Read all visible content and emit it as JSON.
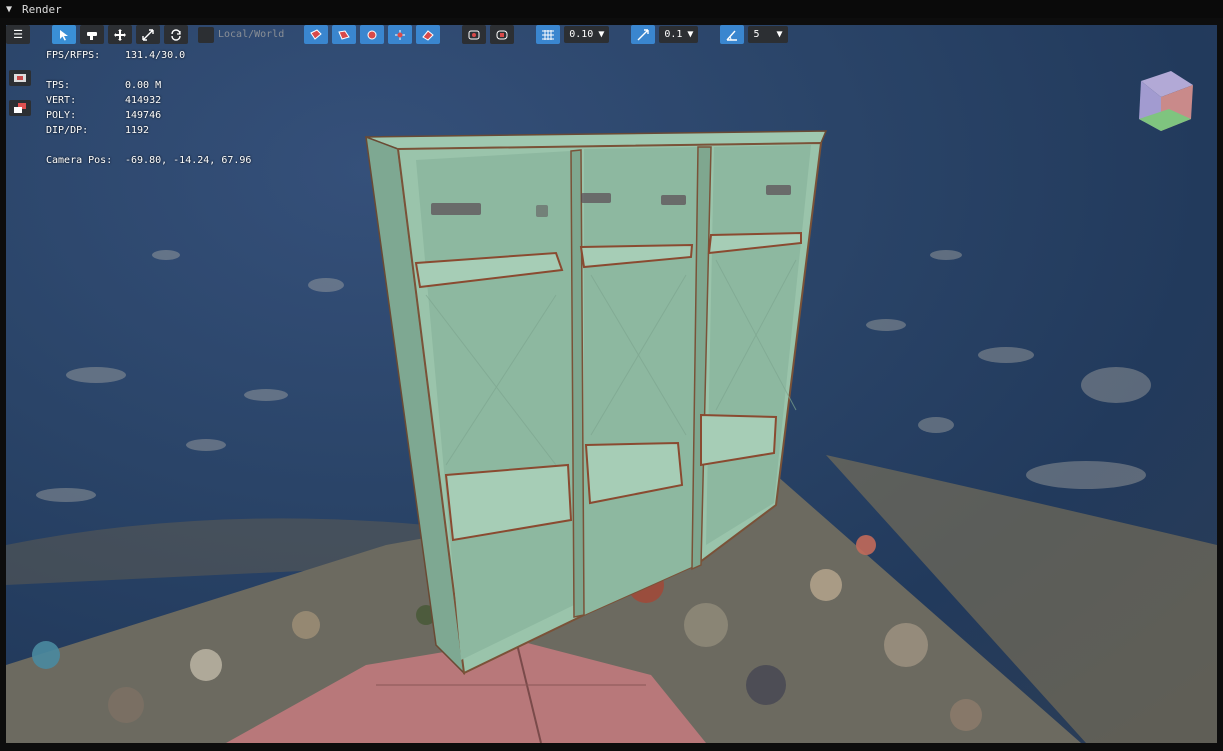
{
  "window": {
    "title": "Render"
  },
  "toolbar": {
    "space_mode_label": "Local/World",
    "snap_translate_value": "0.10",
    "snap_scale_value": "0.1",
    "snap_angle_value": "5"
  },
  "stats": [
    {
      "key": "FPS/RFPS:",
      "value": "131.4/30.0"
    },
    {
      "key": "TPS:",
      "value": "0.00 M"
    },
    {
      "key": "VERT:",
      "value": "414932"
    },
    {
      "key": "POLY:",
      "value": "149746"
    },
    {
      "key": "DIP/DP:",
      "value": "1192"
    },
    {
      "key": "Camera Pos:",
      "value": "-69.80, -14.24, 67.96"
    }
  ],
  "colors": {
    "accent": "#3a8fd6",
    "locker": "#8fbfa3",
    "rust": "#8a4a30"
  }
}
